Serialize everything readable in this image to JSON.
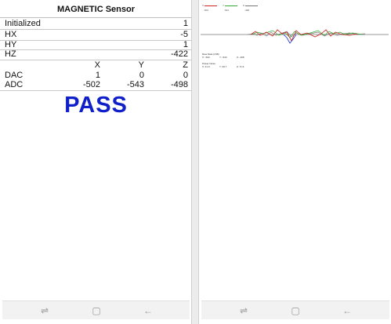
{
  "left_screen": {
    "title": "MAGNETIC Sensor",
    "rows": [
      {
        "label": "Initialized",
        "value": "1"
      },
      {
        "label": "HX",
        "value": "-5"
      },
      {
        "label": "HY",
        "value": "1"
      },
      {
        "label": "HZ",
        "value": "-422"
      }
    ],
    "table_header": [
      "X",
      "Y",
      "Z"
    ],
    "dac": {
      "label": "DAC",
      "x": "1",
      "y": "0",
      "z": "0"
    },
    "adc": {
      "label": "ADC",
      "x": "-502",
      "y": "-543",
      "z": "-498"
    },
    "result": "PASS",
    "result_color": "#1020c8"
  },
  "right_screen": {
    "legend": [
      {
        "tag": "X:",
        "value": "-502",
        "color": "#cc2222"
      },
      {
        "tag": "Y:",
        "value": "-543",
        "color": "#33aa33"
      },
      {
        "tag": "Z:",
        "value": "-498",
        "color": "#777777"
      }
    ],
    "raw_data": {
      "header": "Raw Data (LSB)",
      "x": "X: -502",
      "y": "Y: -543",
      "z": "Z: -498"
    },
    "power_noise": {
      "header": "Power Noise",
      "x": "X: 41.9",
      "y": "Y: 29.7",
      "z": "Z: 71.9"
    }
  },
  "navbar": {
    "recent_icon": "recent-apps-icon",
    "home_icon": "home-icon",
    "back_icon": "back-icon"
  }
}
